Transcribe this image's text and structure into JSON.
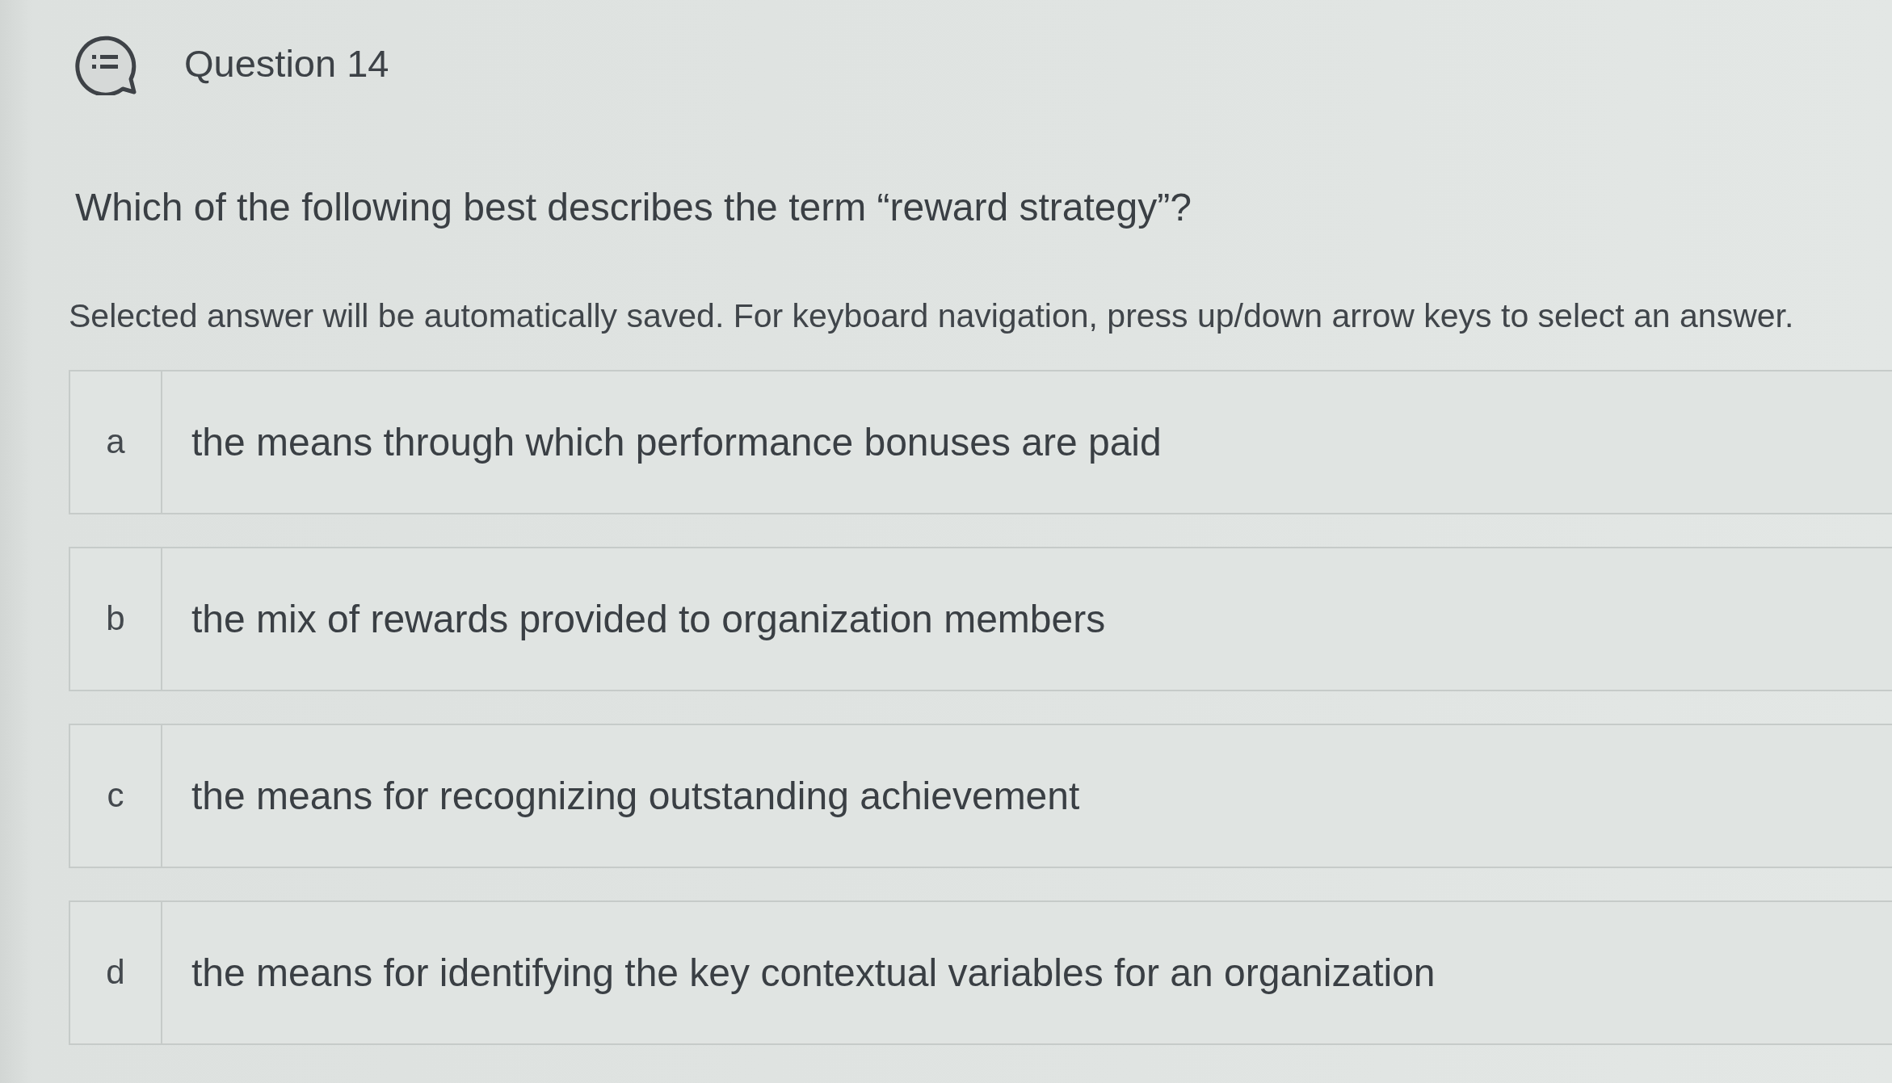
{
  "question": {
    "title": "Question 14",
    "text": "Which of the following best describes the term “reward strategy”?",
    "instructions": "Selected answer will be automatically saved. For keyboard navigation, press up/down arrow keys to select an answer."
  },
  "answers": [
    {
      "letter": "a",
      "text": "the means through which performance bonuses are paid",
      "selected": false
    },
    {
      "letter": "b",
      "text": "the mix of rewards provided to organization members",
      "selected": false
    },
    {
      "letter": "c",
      "text": "the means for recognizing outstanding achievement",
      "selected": false
    },
    {
      "letter": "d",
      "text": "the means for identifying the key contextual variables for an organization",
      "selected": false
    }
  ]
}
